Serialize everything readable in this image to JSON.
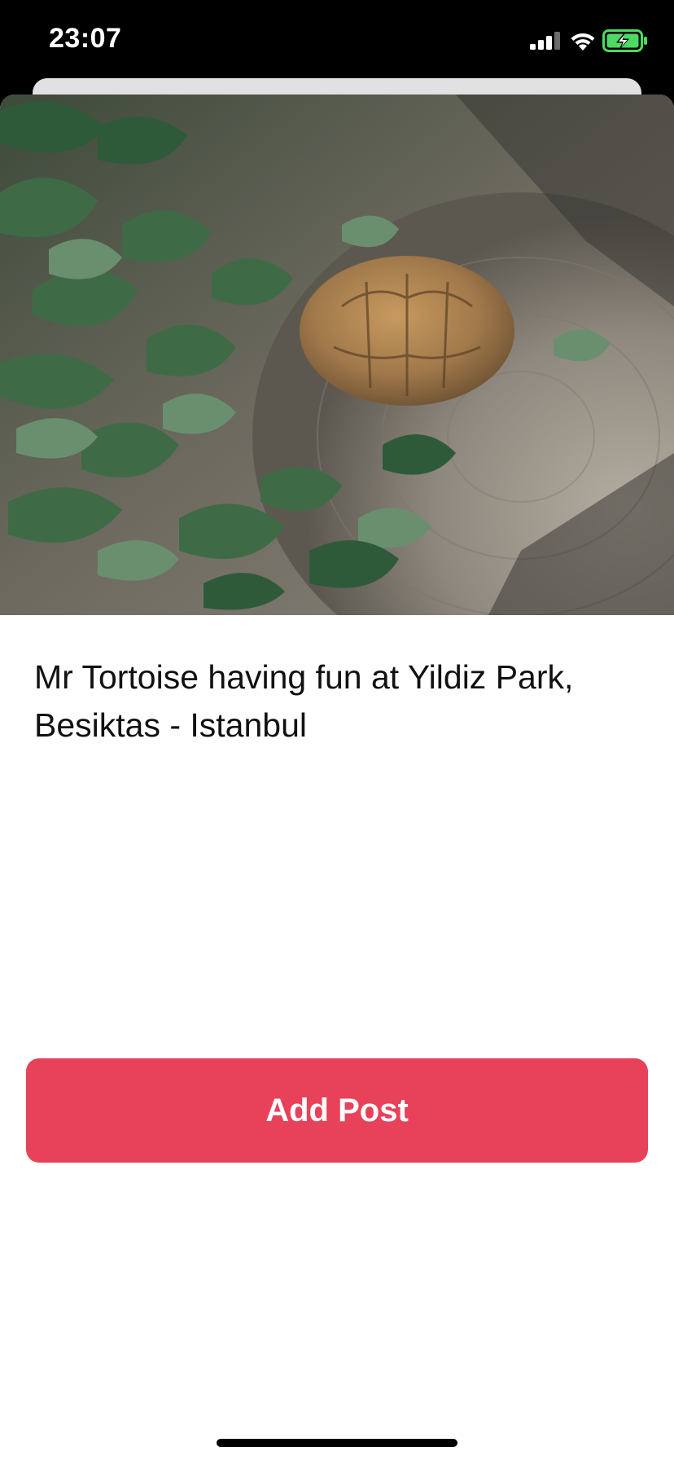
{
  "status_bar": {
    "time": "23:07",
    "icons": [
      "signal-icon",
      "wifi-icon",
      "battery-charging-icon"
    ]
  },
  "post": {
    "photo_subject": "tortoise-photo",
    "caption": "Mr Tortoise having fun at Yildiz Park, Besiktas - Istanbul"
  },
  "actions": {
    "add_post_label": "Add Post"
  },
  "colors": {
    "accent": "#e8415a",
    "battery": "#4cd964"
  }
}
